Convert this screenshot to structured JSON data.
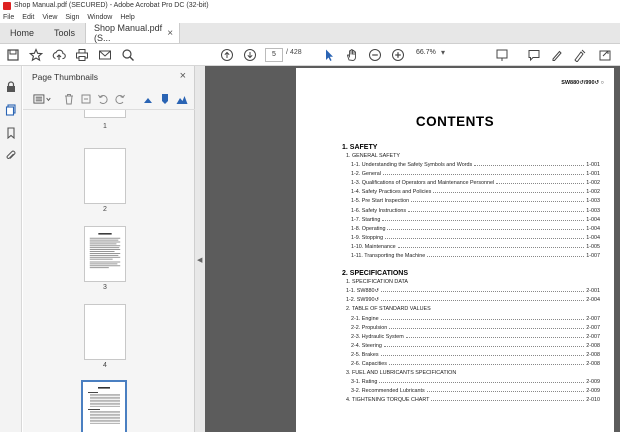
{
  "window": {
    "title": "Shop Manual.pdf (SECURED) - Adobe Acrobat Pro DC (32-bit)"
  },
  "menu": [
    "File",
    "Edit",
    "View",
    "Sign",
    "Window",
    "Help"
  ],
  "tabs": {
    "home": "Home",
    "tools": "Tools",
    "doc": "Shop Manual.pdf (S..."
  },
  "toolbar": {
    "current_page": "5",
    "separator": "/",
    "total_pages": "428",
    "zoom": "66.7%"
  },
  "panel": {
    "title": "Page Thumbnails",
    "thumb_labels": [
      "1",
      "2",
      "3",
      "4"
    ]
  },
  "document": {
    "header_code": "SW880↺/990↺ ○",
    "heading": "CONTENTS",
    "sections": [
      {
        "title": "1. SAFETY",
        "rows": [
          {
            "label": "1. GENERAL SAFETY",
            "page": "",
            "indent": 1
          },
          {
            "label": "1-1. Understanding the Safety Symbols and Words",
            "page": "1-001",
            "indent": 2
          },
          {
            "label": "1-2. General",
            "page": "1-001",
            "indent": 2
          },
          {
            "label": "1-3. Qualifications of Operators and Maintenance Personnel",
            "page": "1-002",
            "indent": 2
          },
          {
            "label": "1-4. Safety Practices and Policies",
            "page": "1-002",
            "indent": 2
          },
          {
            "label": "1-5. Pre Start Inspection",
            "page": "1-003",
            "indent": 2
          },
          {
            "label": "1-6. Safety Instructions",
            "page": "1-003",
            "indent": 2
          },
          {
            "label": "1-7. Starting",
            "page": "1-004",
            "indent": 2
          },
          {
            "label": "1-8. Operating",
            "page": "1-004",
            "indent": 2
          },
          {
            "label": "1-9. Stopping",
            "page": "1-004",
            "indent": 2
          },
          {
            "label": "1-10. Maintenance",
            "page": "1-005",
            "indent": 2
          },
          {
            "label": "1-11. Transporting the Machine",
            "page": "1-007",
            "indent": 2
          }
        ]
      },
      {
        "title": "2. SPECIFICATIONS",
        "rows": [
          {
            "label": "1. SPECIFICATION DATA",
            "page": "",
            "indent": 1
          },
          {
            "label": "1-1. SW880↺",
            "page": "2-001",
            "indent": 1
          },
          {
            "label": "1-2. SW990↺",
            "page": "2-004",
            "indent": 1
          },
          {
            "label": "2. TABLE OF STANDARD VALUES",
            "page": "",
            "indent": 1
          },
          {
            "label": "2-1. Engine",
            "page": "2-007",
            "indent": 2
          },
          {
            "label": "2-2. Propulsion",
            "page": "2-007",
            "indent": 2
          },
          {
            "label": "2-3. Hydraulic System",
            "page": "2-007",
            "indent": 2
          },
          {
            "label": "2-4. Steering",
            "page": "2-008",
            "indent": 2
          },
          {
            "label": "2-5. Brakes",
            "page": "2-008",
            "indent": 2
          },
          {
            "label": "2-6. Capacities",
            "page": "2-008",
            "indent": 2
          },
          {
            "label": "3. FUEL AND LUBRICANTS SPECIFICATION",
            "page": "",
            "indent": 1
          },
          {
            "label": "3-1. Rating",
            "page": "2-009",
            "indent": 2
          },
          {
            "label": "3-2. Recommended Lubricants",
            "page": "2-009",
            "indent": 2
          },
          {
            "label": "4. TIGHTENING TORQUE CHART",
            "page": "2-010",
            "indent": 1
          }
        ]
      }
    ]
  }
}
